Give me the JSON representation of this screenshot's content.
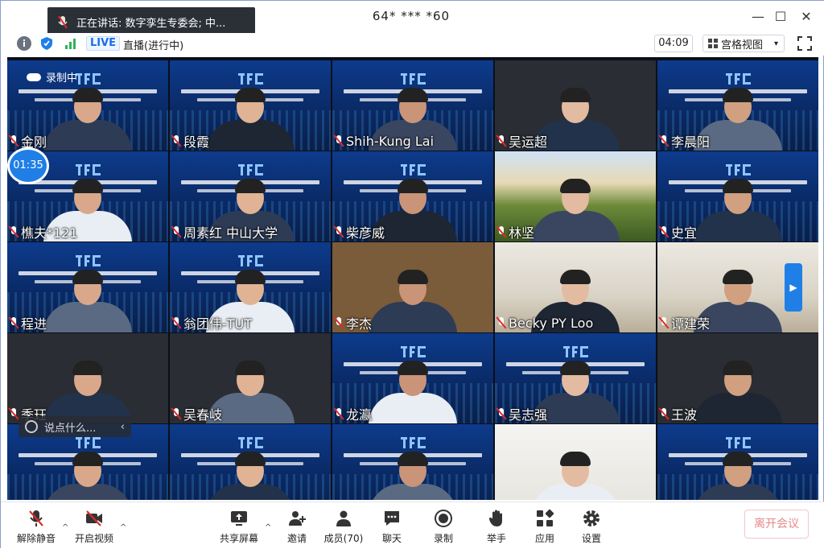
{
  "title_bar": {
    "speaking_label": "正在讲话: 数字孪生专委会; 中...",
    "window_title": "64* *** *60",
    "minimize": "—",
    "maximize": "☐",
    "close": "✕"
  },
  "info_bar": {
    "live_badge": "LIVE",
    "live_status": "直播(进行中)",
    "elapsed": "04:09",
    "view_mode": "宫格视图",
    "view_caret": "▾"
  },
  "gallery": {
    "recording_label": "录制中",
    "call_timer": "01:35",
    "chat_placeholder": "说点什么...",
    "chat_collapse": "‹",
    "side_arrow": "▶",
    "tiles": [
      {
        "name": "金刚",
        "bg": "blue"
      },
      {
        "name": "段霞",
        "bg": "blue"
      },
      {
        "name": "Shih-Kung Lai",
        "bg": "blue"
      },
      {
        "name": "吴运超",
        "bg": "dark"
      },
      {
        "name": "李晨阳",
        "bg": "blue"
      },
      {
        "name": "樵夫*121",
        "bg": "blue"
      },
      {
        "name": "周素红 中山大学",
        "bg": "blue"
      },
      {
        "name": "柴彦威",
        "bg": "blue"
      },
      {
        "name": "林坚",
        "bg": "photo1"
      },
      {
        "name": "史宜",
        "bg": "blue"
      },
      {
        "name": "程进",
        "bg": "blue"
      },
      {
        "name": "翁团伟-TUT",
        "bg": "blue"
      },
      {
        "name": "李杰",
        "bg": "green"
      },
      {
        "name": "Becky PY Loo",
        "bg": "room"
      },
      {
        "name": "谭建荣",
        "bg": "room"
      },
      {
        "name": "季珏",
        "bg": "dark"
      },
      {
        "name": "吴春岐",
        "bg": "dark"
      },
      {
        "name": "龙瀛",
        "bg": "blue"
      },
      {
        "name": "吴志强",
        "bg": "blue"
      },
      {
        "name": "王波",
        "bg": "dark"
      },
      {
        "name": "",
        "bg": "blue"
      },
      {
        "name": "",
        "bg": "blue"
      },
      {
        "name": "",
        "bg": "blue"
      },
      {
        "name": "",
        "bg": "room2"
      },
      {
        "name": "",
        "bg": "blue"
      }
    ]
  },
  "toolbar": {
    "unmute": "解除静音",
    "start_video": "开启视频",
    "share_screen": "共享屏幕",
    "invite": "邀请",
    "members": "成员(70)",
    "chat": "聊天",
    "record": "录制",
    "raise_hand": "举手",
    "apps": "应用",
    "settings": "设置",
    "caret": "^",
    "end_meeting": "离开会议"
  }
}
